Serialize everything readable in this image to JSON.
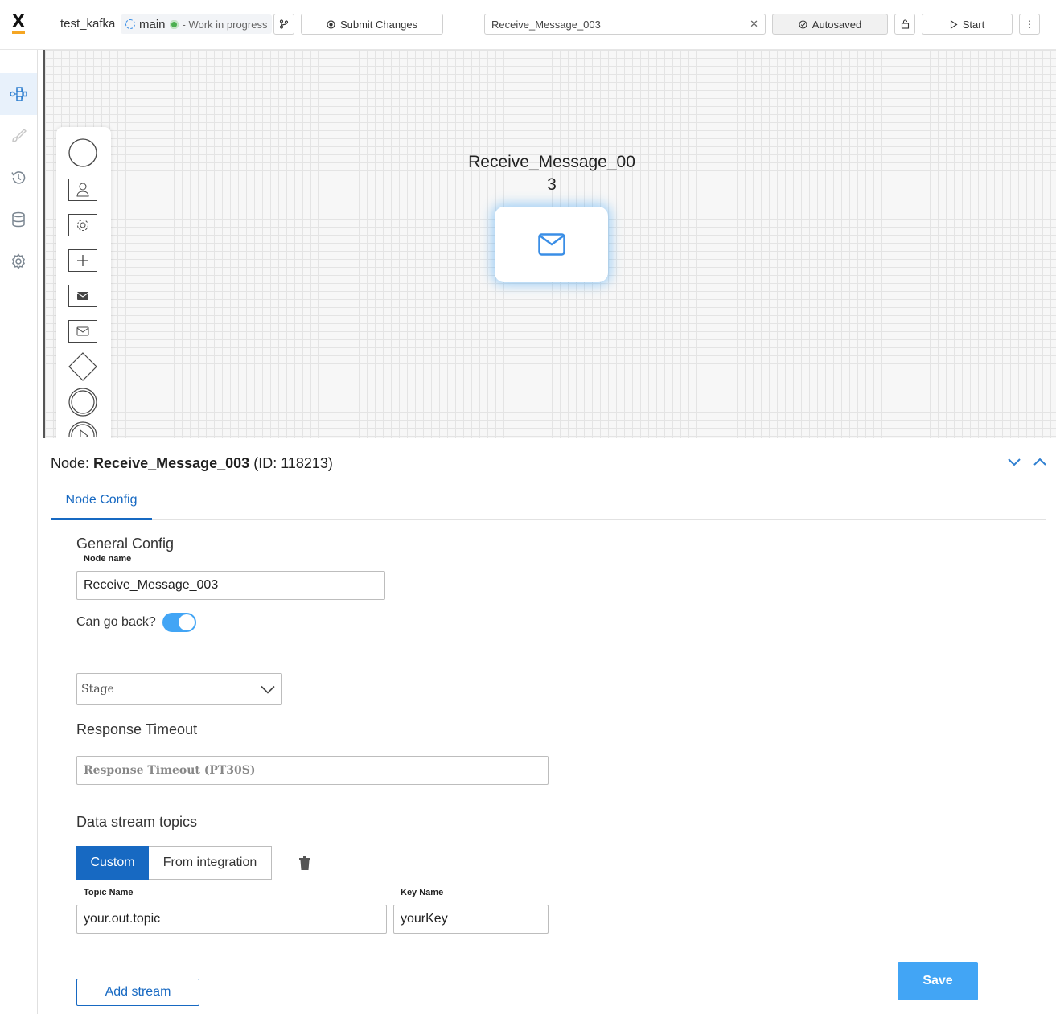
{
  "header": {
    "project_name": "test_kafka",
    "branch_name": "main",
    "branch_status": "- Work in progress",
    "submit_label": "Submit Changes",
    "search_value": "Receive_Message_003",
    "autosaved_label": "Autosaved",
    "start_label": "Start"
  },
  "sidebar": {
    "items": [
      {
        "icon": "process-diagram-icon",
        "active": true
      },
      {
        "icon": "brush-icon",
        "active": false
      },
      {
        "icon": "history-icon",
        "active": false
      },
      {
        "icon": "database-icon",
        "active": false
      },
      {
        "icon": "settings-gear-icon",
        "active": false
      }
    ]
  },
  "palette": {
    "items": [
      "start-event-icon",
      "user-task-icon",
      "service-task-icon",
      "subprocess-icon",
      "send-message-icon",
      "receive-message-icon",
      "gateway-icon",
      "intermediate-event-icon",
      "play-event-icon"
    ]
  },
  "canvas": {
    "node_title_line1": "Receive_Message_00",
    "node_title_line2": "3"
  },
  "panel": {
    "node_prefix": "Node: ",
    "node_name": "Receive_Message_003",
    "node_id": " (ID: 118213)",
    "tab_label": "Node Config",
    "general_config_title": "General Config",
    "node_name_label": "Node name",
    "node_name_value": "Receive_Message_003",
    "can_go_back_label": "Can go back?",
    "can_go_back": true,
    "stage_placeholder": "Stage",
    "response_timeout_title": "Response Timeout",
    "response_timeout_placeholder": "Response Timeout (PT30S)",
    "data_stream_title": "Data stream topics",
    "mode_custom": "Custom",
    "mode_integration": "From integration",
    "topic_name_label": "Topic Name",
    "topic_name_value": "your.out.topic",
    "key_name_label": "Key Name",
    "key_name_value": "yourKey",
    "add_stream_label": "Add stream",
    "save_label": "Save"
  },
  "colors": {
    "accent": "#1769c2",
    "save_button": "#42a5f5",
    "toggle_on": "#42a5f5",
    "logo_bar": "#f5a623"
  }
}
